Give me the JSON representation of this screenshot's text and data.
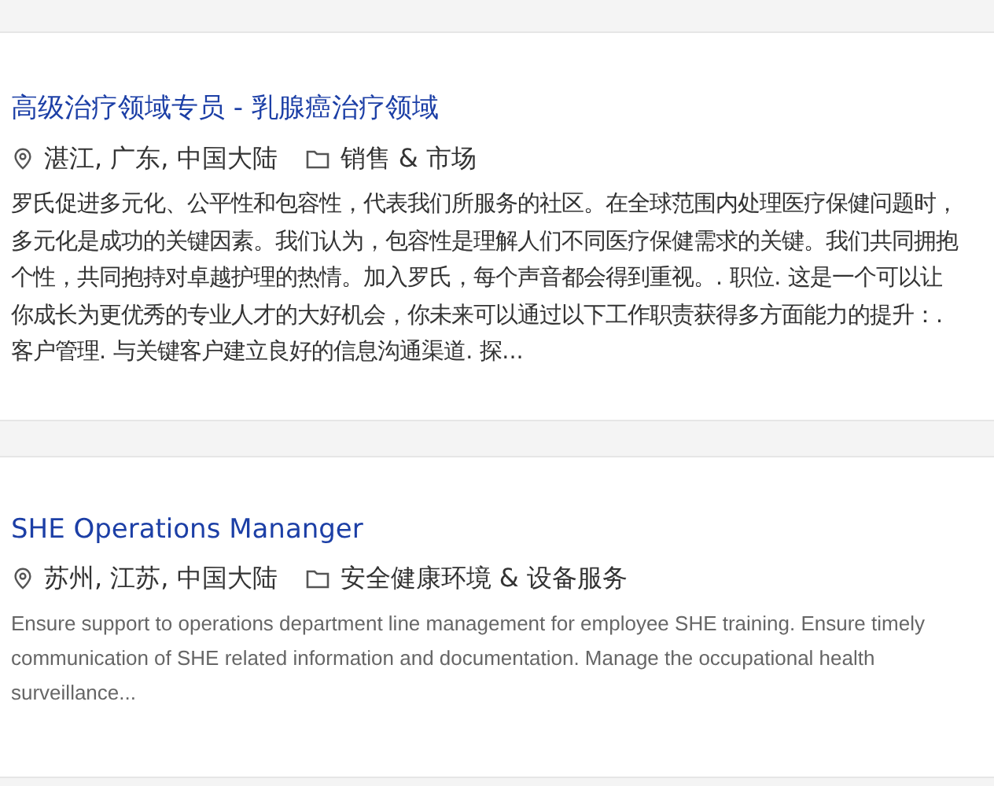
{
  "jobs": [
    {
      "title": "高级治疗领域专员 - 乳腺癌治疗领域",
      "location": "湛江, 广东, 中国大陆",
      "category": "销售 & 市场",
      "description": "罗氏促进多元化、公平性和包容性，代表我们所服务的社区。在全球范围内处理医疗保健问题时，多元化是成功的关键因素。我们认为，包容性是理解人们不同医疗保健需求的关键。我们共同拥抱个性，共同抱持对卓越护理的热情。加入罗氏，每个声音都会得到重视。. 职位. 这是一个可以让你成长为更优秀的专业人才的大好机会，你未来可以通过以下工作职责获得多方面能力的提升：. 客户管理. 与关键客户建立良好的信息沟通渠道. 探..."
    },
    {
      "title": "SHE Operations Mananger",
      "location": "苏州, 江苏, 中国大陆",
      "category": "安全健康环境 & 设备服务",
      "description": "Ensure support to operations department line management for employee SHE training. Ensure timely communication of SHE related information and documentation. Manage the occupational health surveillance..."
    }
  ]
}
